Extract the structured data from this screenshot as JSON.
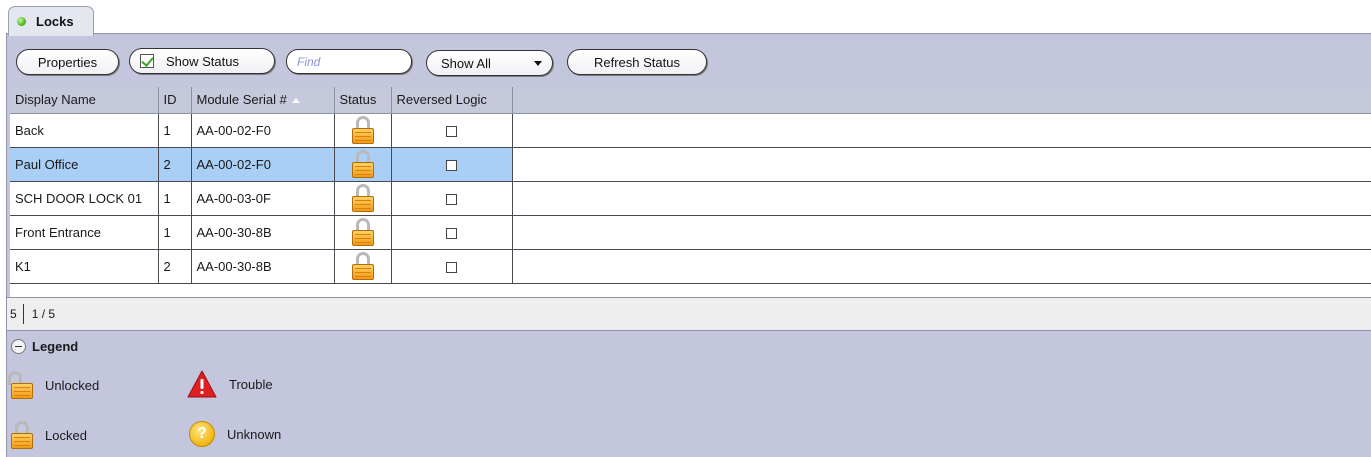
{
  "tab": {
    "label": "Locks"
  },
  "toolbar": {
    "properties_label": "Properties",
    "show_status_label": "Show Status",
    "find_placeholder": "Find",
    "filter_value": "Show All",
    "refresh_label": "Refresh Status"
  },
  "grid": {
    "columns": [
      "Display Name",
      "ID",
      "Module Serial #",
      "Status",
      "Reversed Logic"
    ],
    "sorted_column": "Module Serial #",
    "rows": [
      {
        "name": "Back",
        "id": "1",
        "serial": "AA-00-02-F0",
        "status": "locked",
        "reversed": false,
        "selected": false
      },
      {
        "name": "Paul Office",
        "id": "2",
        "serial": "AA-00-02-F0",
        "status": "locked",
        "reversed": false,
        "selected": true
      },
      {
        "name": "SCH DOOR LOCK 01",
        "id": "1",
        "serial": "AA-00-03-0F",
        "status": "locked",
        "reversed": false,
        "selected": false
      },
      {
        "name": "Front Entrance",
        "id": "1",
        "serial": "AA-00-30-8B",
        "status": "locked",
        "reversed": false,
        "selected": false
      },
      {
        "name": "K1",
        "id": "2",
        "serial": "AA-00-30-8B",
        "status": "locked",
        "reversed": false,
        "selected": false
      }
    ]
  },
  "pager": {
    "count": "5",
    "page": "1 / 5"
  },
  "legend": {
    "title": "Legend",
    "unlocked": "Unlocked",
    "locked": "Locked",
    "trouble": "Trouble",
    "unknown": "Unknown"
  },
  "colors": {
    "panel": "#c4c6de",
    "selected_row": "#a9cff6",
    "status_green": "#3bb30c"
  }
}
